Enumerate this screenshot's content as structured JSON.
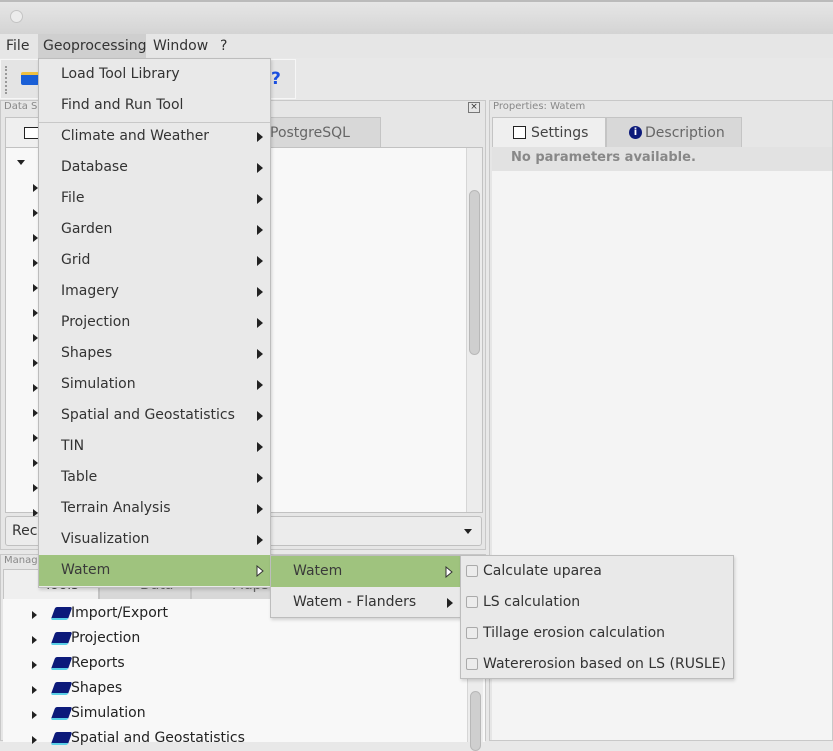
{
  "menubar": {
    "items": [
      "File",
      "Geoprocessing",
      "Window",
      "?"
    ]
  },
  "data_panel": {
    "title": "Data S",
    "tabs": [
      "",
      "PostgreSQL"
    ],
    "combo_value": "Reco"
  },
  "properties_panel": {
    "title": "Properties: Watem",
    "tabs": [
      "Settings",
      "Description"
    ],
    "message": "No parameters available."
  },
  "manager_panel": {
    "title": "Manag",
    "tabs": [
      "Tools",
      "Data",
      "Maps"
    ],
    "tree_items": [
      "Import/Export",
      "Projection",
      "Reports",
      "Shapes",
      "Simulation",
      "Spatial and Geostatistics"
    ]
  },
  "geoprocessing_menu": {
    "top_items": [
      "Load Tool Library",
      "Find and Run Tool"
    ],
    "submenu_items": [
      "Climate and Weather",
      "Database",
      "File",
      "Garden",
      "Grid",
      "Imagery",
      "Projection",
      "Shapes",
      "Simulation",
      "Spatial and Geostatistics",
      "TIN",
      "Table",
      "Terrain Analysis",
      "Visualization",
      "Watem"
    ],
    "highlighted": "Watem"
  },
  "watem_submenu": {
    "items": [
      "Watem",
      "Watem - Flanders"
    ],
    "highlighted": "Watem"
  },
  "watem_tools_menu": {
    "items": [
      "Calculate uparea",
      "LS calculation",
      "Tillage erosion calculation",
      "Watererosion based on LS (RUSLE)"
    ]
  },
  "colors": {
    "highlight": "#9fc37e",
    "icon_blue": "#0c1a7a"
  }
}
